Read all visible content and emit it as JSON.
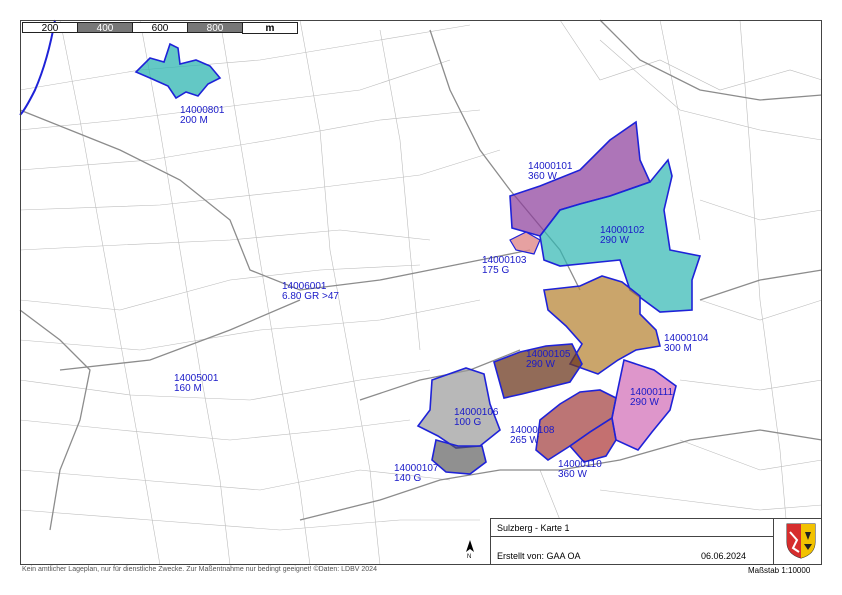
{
  "scale_bar": {
    "ticks": [
      "200",
      "400",
      "600",
      "800"
    ],
    "unit": "m"
  },
  "parcels": [
    {
      "id": "p14000801",
      "label": "14000801\n200 M",
      "color": "#2fb6b2"
    },
    {
      "id": "p14000101",
      "label": "14000101\n360 W",
      "color": "#8a3a9a"
    },
    {
      "id": "p14000102",
      "label": "14000102\n290 W",
      "color": "#2fb6b2"
    },
    {
      "id": "p14000103",
      "label": "14000103\n175 G",
      "color": "#e08a8a"
    },
    {
      "id": "p14006001",
      "label": "14006001\n6.80 GR >47",
      "color": "none"
    },
    {
      "id": "p14000104",
      "label": "14000104\n300 M",
      "color": "#b8873a"
    },
    {
      "id": "p14000105",
      "label": "14000105\n290 W",
      "color": "#6e3a20"
    },
    {
      "id": "p14005001",
      "label": "14005001\n160 M",
      "color": "none"
    },
    {
      "id": "p14000106",
      "label": "14000106\n100 G",
      "color": "#9a9a9a"
    },
    {
      "id": "p14000111",
      "label": "14000111\n290 W",
      "color": "#c850a8"
    },
    {
      "id": "p14000108",
      "label": "14000108\n265 W",
      "color": "#a03a3a"
    },
    {
      "id": "p14000110",
      "label": "14000110\n360 W",
      "color": "#b04040"
    },
    {
      "id": "p14000107",
      "label": "14000107\n140 G",
      "color": "#555555"
    }
  ],
  "info_box": {
    "title": "Sulzberg - Karte 1",
    "author": "Erstellt von: GAA OA",
    "date": "06.06.2024"
  },
  "disclaimer": "Kein amtlicher Lageplan, nur für dienstliche Zwecke. Zur Maßentnahme nur bedingt geeignet! ©Daten: LDBV 2024",
  "scale_text": "Maßstab 1:10000",
  "colors": {
    "boundary": "#1e22d8",
    "label": "#1a1ac8",
    "cadastral": "#b9b9b9",
    "road": "#8d8d8d"
  }
}
